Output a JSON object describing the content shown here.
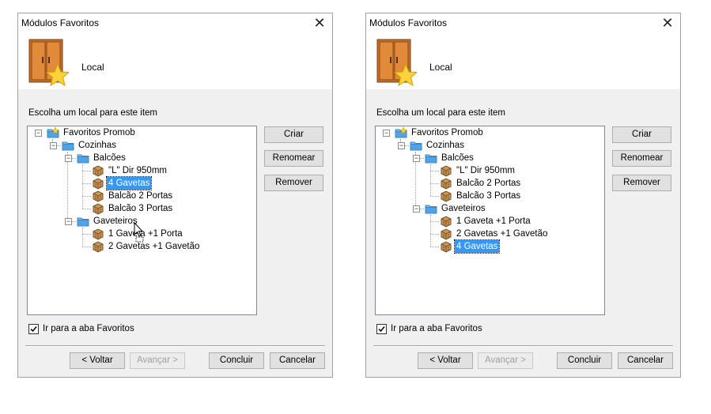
{
  "dialogs": [
    {
      "title": "Módulos Favoritos",
      "header_label": "Local",
      "prompt": "Escolha um local para este item",
      "tree": [
        {
          "label": "Favoritos Promob",
          "icon": "favorites-folder-icon",
          "level": 0,
          "expander": "-",
          "selected": false
        },
        {
          "label": "Cozinhas",
          "icon": "folder-icon",
          "level": 1,
          "expander": "-",
          "selected": false
        },
        {
          "label": "Balcões",
          "icon": "folder-icon",
          "level": 2,
          "expander": "-",
          "selected": false
        },
        {
          "label": "\"L\" Dir 950mm",
          "icon": "module-box-icon",
          "level": 3,
          "expander": "",
          "selected": false
        },
        {
          "label": "4 Gavetas",
          "icon": "module-box-icon",
          "level": 3,
          "expander": "",
          "selected": true
        },
        {
          "label": "Balcão 2 Portas",
          "icon": "module-box-icon",
          "level": 3,
          "expander": "",
          "selected": false
        },
        {
          "label": "Balcão 3 Portas",
          "icon": "module-box-icon",
          "level": 3,
          "expander": "",
          "selected": false
        },
        {
          "label": "Gaveteiros",
          "icon": "folder-icon",
          "level": 2,
          "expander": "-",
          "selected": false
        },
        {
          "label": "1 Gaveta +1 Porta",
          "icon": "module-box-icon",
          "level": 3,
          "expander": "",
          "selected": false
        },
        {
          "label": "2 Gavetas +1 Gavetão",
          "icon": "module-box-icon",
          "level": 3,
          "expander": "",
          "selected": false
        }
      ],
      "buttons": {
        "create": "Criar",
        "rename": "Renomear",
        "remove": "Remover",
        "back": "< Voltar",
        "next": "Avançar >",
        "finish": "Concluir",
        "cancel": "Cancelar"
      },
      "checkbox_label": "Ir para a aba Favoritos",
      "checkbox_checked": true,
      "show_cursor": true
    },
    {
      "title": "Módulos Favoritos",
      "header_label": "Local",
      "prompt": "Escolha um local para este item",
      "tree": [
        {
          "label": "Favoritos Promob",
          "icon": "favorites-folder-icon",
          "level": 0,
          "expander": "-",
          "selected": false
        },
        {
          "label": "Cozinhas",
          "icon": "folder-icon",
          "level": 1,
          "expander": "-",
          "selected": false
        },
        {
          "label": "Balcões",
          "icon": "folder-icon",
          "level": 2,
          "expander": "-",
          "selected": false
        },
        {
          "label": "\"L\" Dir 950mm",
          "icon": "module-box-icon",
          "level": 3,
          "expander": "",
          "selected": false
        },
        {
          "label": "Balcão 2 Portas",
          "icon": "module-box-icon",
          "level": 3,
          "expander": "",
          "selected": false
        },
        {
          "label": "Balcão 3 Portas",
          "icon": "module-box-icon",
          "level": 3,
          "expander": "",
          "selected": false
        },
        {
          "label": "Gaveteiros",
          "icon": "folder-icon",
          "level": 2,
          "expander": "-",
          "selected": false
        },
        {
          "label": "1 Gaveta +1 Porta",
          "icon": "module-box-icon",
          "level": 3,
          "expander": "",
          "selected": false
        },
        {
          "label": "2 Gavetas +1 Gavetão",
          "icon": "module-box-icon",
          "level": 3,
          "expander": "",
          "selected": false
        },
        {
          "label": "4 Gavetas",
          "icon": "module-box-icon",
          "level": 3,
          "expander": "",
          "selected": true
        }
      ],
      "buttons": {
        "create": "Criar",
        "rename": "Renomear",
        "remove": "Remover",
        "back": "< Voltar",
        "next": "Avançar >",
        "finish": "Concluir",
        "cancel": "Cancelar"
      },
      "checkbox_label": "Ir para a aba Favoritos",
      "checkbox_checked": true,
      "show_cursor": false
    }
  ],
  "colors": {
    "selection": "#3399ff",
    "folder": "#4fa3e6",
    "module": "#c9965a",
    "star": "#ffd23a"
  }
}
